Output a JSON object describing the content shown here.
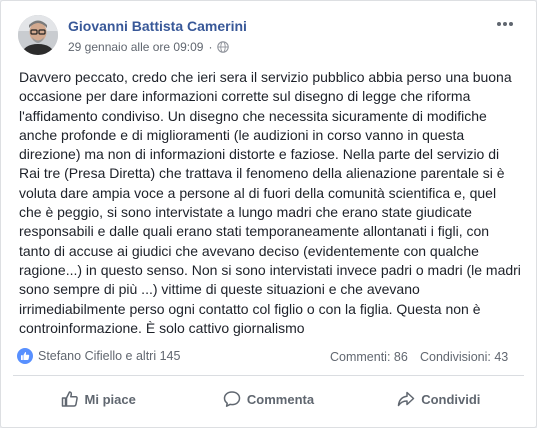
{
  "post": {
    "author": "Giovanni Battista Camerini",
    "date": "29 gennaio alle ore 09:09",
    "separator": "·",
    "privacy_icon": "globe-icon",
    "text": "Davvero peccato, credo che ieri sera il servizio pubblico abbia perso una buona occasione per dare informazioni corrette sul disegno di legge che riforma l'affidamento condiviso. Un disegno che necessita sicuramente di modifiche anche profonde e di miglioramenti (le audizioni in corso vanno in questa direzione) ma non di informazioni distorte e faziose. Nella parte del servizio di Rai tre (Presa Diretta) che trattava il fenomeno della alienazione parentale si è voluta dare ampia voce a persone al di fuori della comunità scientifica e, quel che è peggio, si sono intervistate a lungo madri che erano state giudicate responsabili e dalle quali erano stati temporaneamente allontanati i figli, con tanto di accuse ai giudici che avevano deciso (evidentemente con qualche ragione...) in questo senso. Non si sono intervistati invece padri o madri (le madri sono sempre di più ...) vittime di queste situazioni e che avevano irrimediabilmente perso ogni contatto col figlio o con la figlia. Questa non è controinformazione. È solo cattivo giornalismo"
  },
  "stats": {
    "likes": "Stefano Cifiello e altri 145",
    "comments": "Commenti: 86",
    "shares": "Condivisioni: 43"
  },
  "actions": {
    "like": "Mi piace",
    "comment": "Commenta",
    "share": "Condividi"
  },
  "colors": {
    "author": "#385898",
    "like_badge": "#5890ff",
    "text": "#1d2129",
    "muted": "#616770"
  }
}
